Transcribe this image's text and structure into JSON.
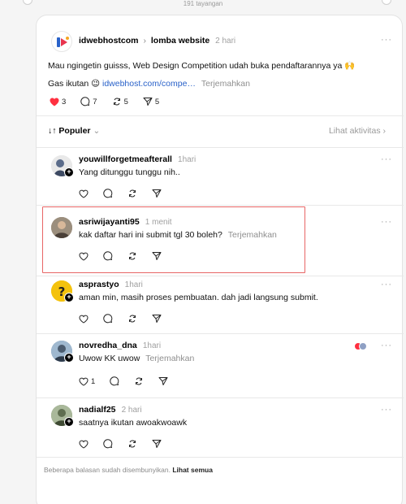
{
  "header": {
    "views": "191 tayangan"
  },
  "post": {
    "account": "idwebhostcom",
    "community": "lomba website",
    "time": "2 hari",
    "line1": "Mau ngingetin guisss, Web Design Competition udah buka pendaftarannya ya 🙌",
    "line2_prefix": "Gas ikutan 😉",
    "link": "idwebhost.com/compe…",
    "translate": "Terjemahkan",
    "likes": "3",
    "replies": "7",
    "reposts": "5",
    "shares": "5"
  },
  "filter": {
    "label": "Populer",
    "activity": "Lihat aktivitas"
  },
  "comments": [
    {
      "user": "youwillforgetmeafterall",
      "time": "1hari",
      "text": "Yang ditunggu tunggu nih..",
      "translate": "",
      "likes": ""
    },
    {
      "user": "asriwijayanti95",
      "time": "1 menit",
      "text": "kak daftar hari ini submit tgl 30 boleh?",
      "translate": "Terjemahkan",
      "likes": ""
    },
    {
      "user": "asprastyo",
      "time": "1hari",
      "text": "aman min, masih proses pembuatan. dah jadi langsung submit.",
      "translate": "",
      "likes": ""
    },
    {
      "user": "novredha_dna",
      "time": "1hari",
      "text": "Uwow KK uwow",
      "translate": "Terjemahkan",
      "likes": "1"
    },
    {
      "user": "nadialf25",
      "time": "2 hari",
      "text": "saatnya ikutan awoakwoawk",
      "translate": "",
      "likes": ""
    }
  ],
  "footer": {
    "hidden_text": "Beberapa balasan sudah disembunyikan.",
    "see_all": "Lihat semua"
  },
  "icons": {
    "more": "more-icon",
    "heart": "heart-icon",
    "comment": "comment-icon",
    "repost": "repost-icon",
    "share": "share-icon",
    "sort": "sort-icon",
    "chevron": "chevron-right-icon"
  },
  "colors": {
    "heart": "#ff3040",
    "link": "#2a62c9",
    "highlight": "#e86565"
  }
}
